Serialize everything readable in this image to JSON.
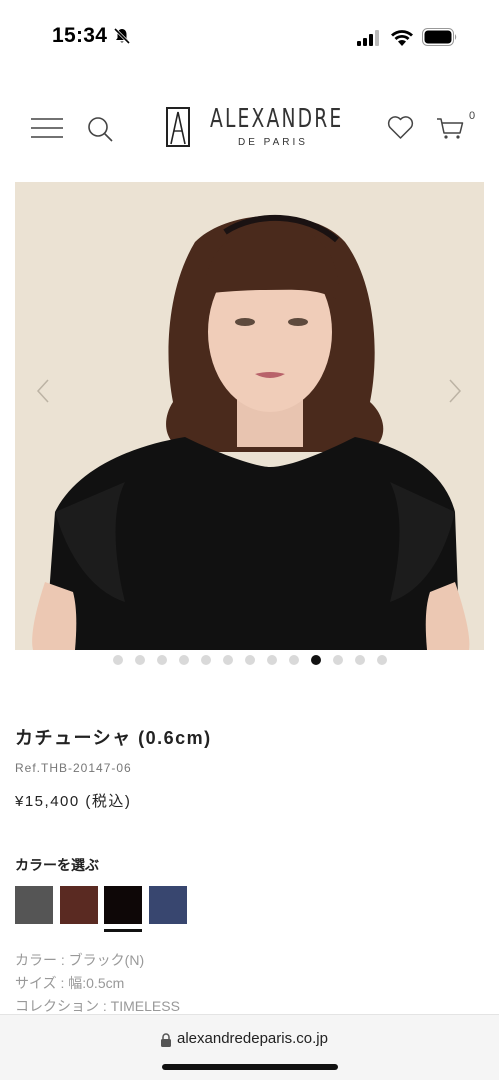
{
  "status_bar": {
    "time": "15:34"
  },
  "header": {
    "brand_name": "ALEXANDRE",
    "brand_sub": "DE PARIS",
    "cart_count": "0"
  },
  "gallery": {
    "dot_count": 13,
    "active_index": 9
  },
  "product": {
    "title": "カチューシャ (0.6cm)",
    "ref": "Ref.THB-20147-06",
    "price": "¥15,400 (税込)"
  },
  "color_select": {
    "heading": "カラーを選ぶ",
    "swatches": [
      {
        "color": "#555555",
        "selected": false
      },
      {
        "color": "#5a2a22",
        "selected": false
      },
      {
        "color": "#0e0707",
        "selected": true
      },
      {
        "color": "#38466f",
        "selected": false
      }
    ]
  },
  "specs": {
    "color": "カラー : ブラック(N)",
    "size": "サイズ : 幅:0.5cm",
    "collection": "コレクション : TIMELESS"
  },
  "browser": {
    "url": "alexandredeparis.co.jp"
  }
}
